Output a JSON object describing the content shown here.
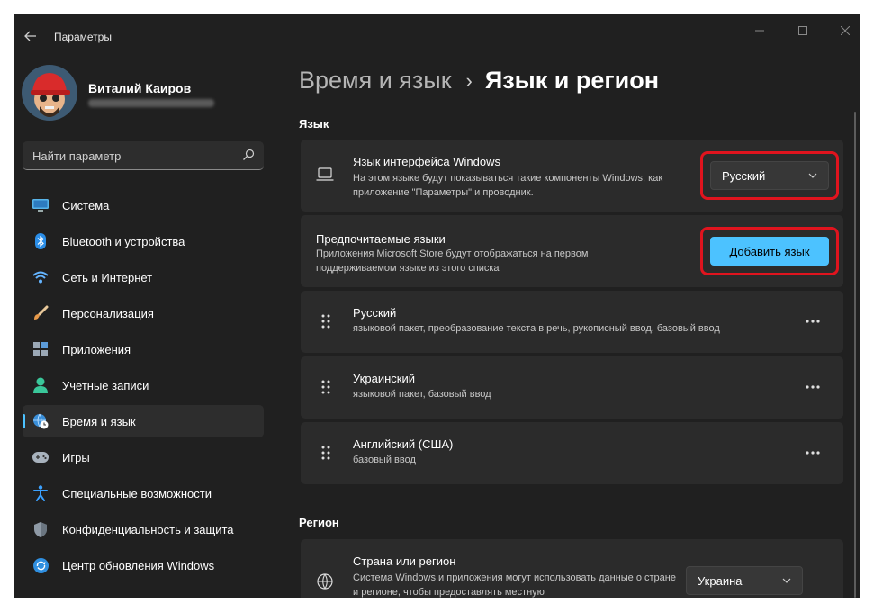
{
  "window": {
    "title": "Параметры",
    "back_icon": "arrow-left-icon",
    "controls": {
      "minimize": "minimize-icon",
      "maximize": "maximize-icon",
      "close": "close-icon"
    }
  },
  "profile": {
    "name": "Виталий Каиров"
  },
  "search": {
    "placeholder": "Найти параметр",
    "icon": "search-icon"
  },
  "sidebar": {
    "active": "Время и язык",
    "items": [
      {
        "label": "Система",
        "icon": "system-monitor-icon"
      },
      {
        "label": "Bluetooth и устройства",
        "icon": "bluetooth-icon"
      },
      {
        "label": "Сеть и Интернет",
        "icon": "wifi-icon"
      },
      {
        "label": "Персонализация",
        "icon": "paintbrush-icon"
      },
      {
        "label": "Приложения",
        "icon": "apps-icon"
      },
      {
        "label": "Учетные записи",
        "icon": "user-icon"
      },
      {
        "label": "Время и язык",
        "icon": "globe-clock-icon"
      },
      {
        "label": "Игры",
        "icon": "gamepad-icon"
      },
      {
        "label": "Специальные возможности",
        "icon": "accessibility-icon"
      },
      {
        "label": "Конфиденциальность и защита",
        "icon": "shield-icon"
      },
      {
        "label": "Центр обновления Windows",
        "icon": "windows-update-icon"
      }
    ]
  },
  "breadcrumb": {
    "parent": "Время и язык",
    "separator": "›",
    "current": "Язык и регион"
  },
  "language_section": {
    "title": "Язык",
    "display_language": {
      "title": "Язык интерфейса Windows",
      "description": "На этом языке будут показываться такие компоненты Windows, как приложение \"Параметры\" и проводник.",
      "value": "Русский",
      "icon": "laptop-icon"
    },
    "preferred_languages": {
      "title": "Предпочитаемые языки",
      "description": "Приложения Microsoft Store будут отображаться на первом поддерживаемом языке из этого списка",
      "button_label": "Добавить язык"
    },
    "languages": [
      {
        "name": "Русский",
        "features": "языковой пакет, преобразование текста в речь, рукописный ввод, базовый ввод"
      },
      {
        "name": "Украинский",
        "features": "языковой пакет, базовый ввод"
      },
      {
        "name": "Английский (США)",
        "features": "базовый ввод"
      }
    ]
  },
  "region_section": {
    "title": "Регион",
    "country": {
      "title": "Страна или регион",
      "description": "Система Windows и приложения могут использовать данные о стране и регионе, чтобы предоставлять местную",
      "value": "Украина",
      "icon": "globe-icon"
    }
  },
  "colors": {
    "background": "#202020",
    "card": "#2b2b2b",
    "accent": "#4cc2ff",
    "highlight": "#e0141e"
  }
}
